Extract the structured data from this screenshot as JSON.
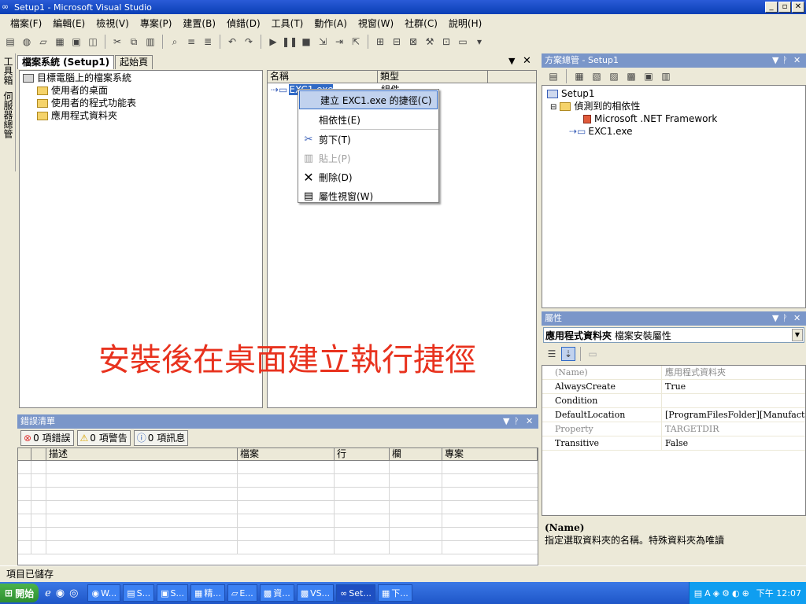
{
  "window": {
    "title": "Setup1 - Microsoft Visual Studio",
    "min": "_",
    "max": "▫",
    "close": "✕"
  },
  "menu": [
    "檔案(F)",
    "編輯(E)",
    "檢視(V)",
    "專案(P)",
    "建置(B)",
    "偵錯(D)",
    "工具(T)",
    "動作(A)",
    "視窗(W)",
    "社群(C)",
    "說明(H)"
  ],
  "side_tabs": {
    "toolbox": "工具箱",
    "server_explorer": "伺服器總管"
  },
  "fs_tabs": {
    "active": "檔案系統 (Setup1)",
    "start": "起始頁",
    "dropdown": "▼",
    "close": "✕"
  },
  "fs_tree": {
    "root": "目標電腦上的檔案系統",
    "children": [
      "使用者的桌面",
      "使用者的程式功能表",
      "應用程式資料夾"
    ]
  },
  "fs_list": {
    "columns": [
      "名稱",
      "類型"
    ],
    "row": {
      "name": "EXC1.exe",
      "type": "組件"
    }
  },
  "context_menu": {
    "create_shortcut": "建立 EXC1.exe 的捷徑(C)",
    "dependencies": "相依性(E)",
    "cut": "剪下(T)",
    "paste": "貼上(P)",
    "delete": "刪除(D)",
    "properties": "屬性視窗(W)"
  },
  "overlay_text": "安裝後在桌面建立執行捷徑",
  "error_list": {
    "title": "錯誤清單",
    "errors": "0 項錯誤",
    "warnings": "0 項警告",
    "messages": "0 項訊息",
    "columns": [
      "",
      "",
      "描述",
      "檔案",
      "行",
      "欄",
      "專案"
    ]
  },
  "solution": {
    "title": "方案總管 - Setup1",
    "root": "Setup1",
    "detected": "偵測到的相依性",
    "framework": "Microsoft .NET Framework",
    "exe": "EXC1.exe"
  },
  "properties": {
    "title": "屬性",
    "object": "應用程式資料夾",
    "object_type": "檔案安裝屬性",
    "rows": [
      {
        "key": "(Name)",
        "value": "應用程式資料夾",
        "gray": true
      },
      {
        "key": "AlwaysCreate",
        "value": "True",
        "gray": false
      },
      {
        "key": "Condition",
        "value": "",
        "gray": false
      },
      {
        "key": "DefaultLocation",
        "value": "[ProgramFilesFolder][Manufacturer]",
        "gray": false
      },
      {
        "key": "Property",
        "value": "TARGETDIR",
        "gray": true
      },
      {
        "key": "Transitive",
        "value": "False",
        "gray": false
      }
    ],
    "desc_title": "(Name)",
    "desc_text": "指定選取資料夾的名稱。特殊資料夾為唯讀"
  },
  "panel_buttons": {
    "dropdown": "▼",
    "pin": "ᚹ",
    "close": "✕"
  },
  "status": "項目已儲存",
  "taskbar": {
    "start": "開始",
    "items": [
      "W...",
      "S...",
      "S...",
      "精...",
      "E...",
      "資...",
      "VS...",
      "Set...",
      "下..."
    ],
    "active_index": 7,
    "clock": "下午 12:07"
  }
}
